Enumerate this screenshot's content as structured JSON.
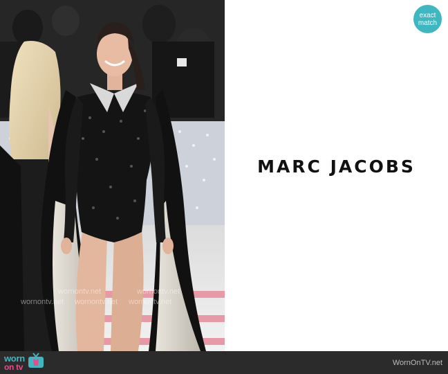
{
  "badge": {
    "line1": "exact",
    "line2": "match"
  },
  "brand": {
    "logo_text": "MARC JACOBS"
  },
  "photo": {
    "watermark_text": "wornontv.net"
  },
  "footer": {
    "logo_word1": "worn",
    "logo_word2": "on tv",
    "site_text": "WornOnTV.net"
  },
  "colors": {
    "accent": "#3fb7c0",
    "logo_pink": "#e94b8a",
    "footer_bg": "#2b2b2b"
  },
  "icons": [
    "tv-icon"
  ]
}
